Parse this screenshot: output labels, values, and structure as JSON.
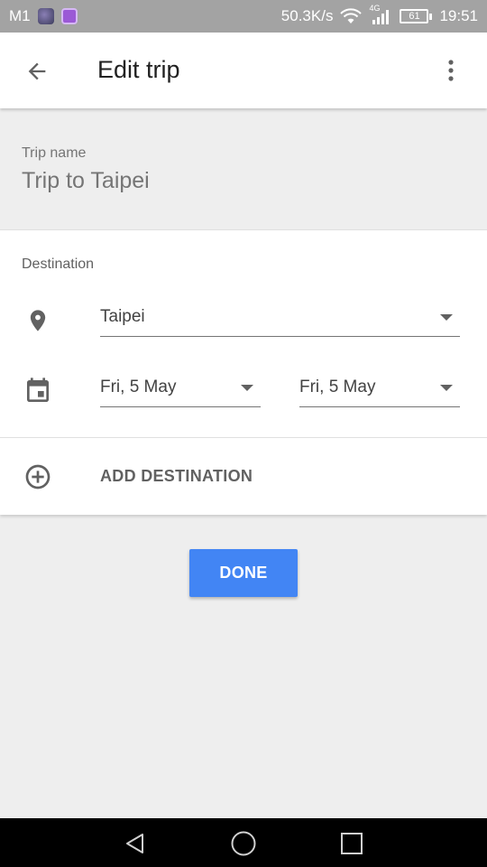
{
  "status_bar": {
    "carrier": "M1",
    "network_speed": "50.3K/s",
    "network_type": "4G",
    "battery": "61",
    "time": "19:51",
    "icons": [
      "gallery-app-icon",
      "photos-app-icon",
      "wifi-icon",
      "signal-icon",
      "battery-icon"
    ]
  },
  "app_bar": {
    "title": "Edit trip",
    "back_icon": "arrow-back-icon",
    "menu_icon": "more-vert-icon"
  },
  "trip_name": {
    "label": "Trip name",
    "value": "Trip to Taipei"
  },
  "destination": {
    "label": "Destination",
    "city": "Taipei",
    "start_date": "Fri, 5 May",
    "end_date": "Fri, 5 May",
    "location_icon": "location-pin-icon",
    "calendar_icon": "calendar-icon"
  },
  "add_destination": {
    "label": "ADD DESTINATION",
    "icon": "add-circle-icon"
  },
  "done_button": {
    "label": "DONE",
    "color": "#4285f4"
  },
  "nav_bar": {
    "icons": [
      "nav-back-icon",
      "nav-home-icon",
      "nav-recents-icon"
    ]
  }
}
